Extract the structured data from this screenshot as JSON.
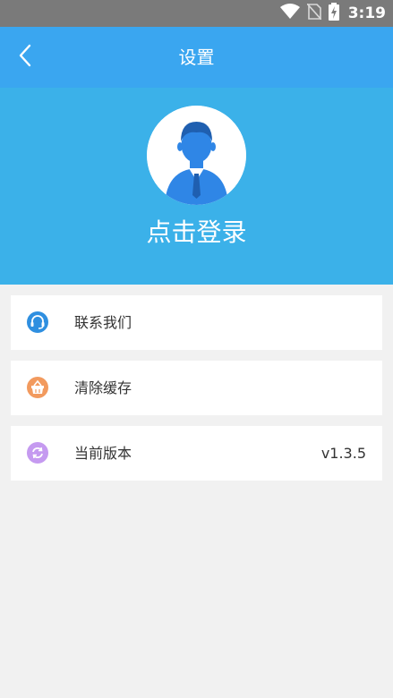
{
  "status_bar": {
    "time": "3:19",
    "icons": [
      "wifi-icon",
      "no-sim-icon",
      "battery-charging-icon"
    ]
  },
  "header": {
    "title": "设置",
    "back_icon": "chevron-left-icon"
  },
  "profile": {
    "avatar_icon": "user-avatar-icon",
    "login_label": "点击登录"
  },
  "settings": {
    "items": [
      {
        "label": "联系我们",
        "icon": "headset-icon",
        "icon_color": "#2f8fe0",
        "value": ""
      },
      {
        "label": "清除缓存",
        "icon": "basket-icon",
        "icon_color": "#f29a5e",
        "value": ""
      },
      {
        "label": "当前版本",
        "icon": "refresh-icon",
        "icon_color": "#c59af0",
        "value": "v1.3.5"
      }
    ]
  },
  "colors": {
    "status_bar": "#7a7a7a",
    "title_bar": "#3aa6f0",
    "profile_header": "#3bb1e9",
    "background": "#f1f1f1"
  }
}
